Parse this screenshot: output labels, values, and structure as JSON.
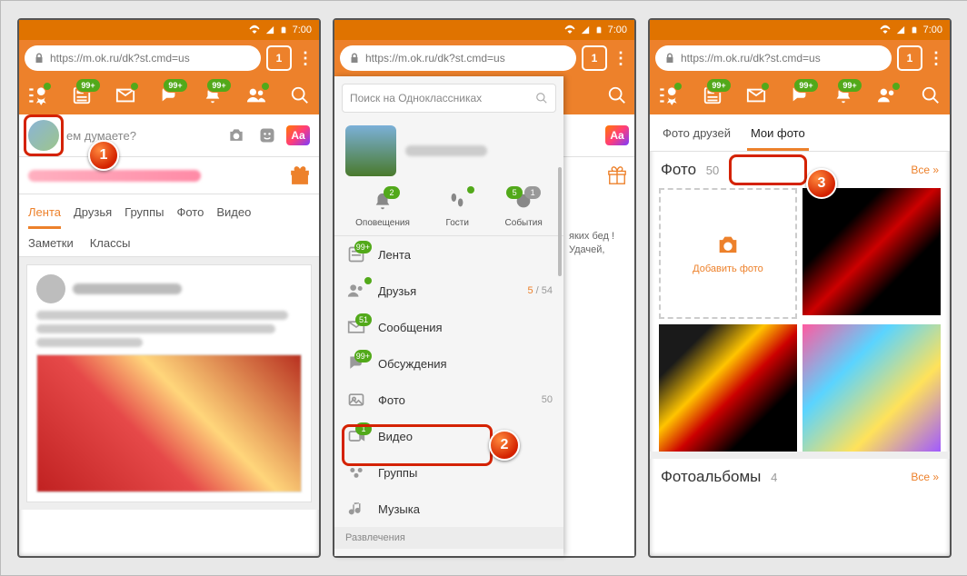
{
  "status": {
    "time": "7:00"
  },
  "urlbar": {
    "url": "https://m.ok.ru/dk?st.cmd=us",
    "tabcount": "1"
  },
  "nav": {
    "badge99": "99+"
  },
  "composer": {
    "prompt": "ем думаете?",
    "aa": "Aa"
  },
  "feedtabs": {
    "lenta": "Лента",
    "druzya": "Друзья",
    "gruppy": "Группы",
    "foto": "Фото",
    "video": "Видео",
    "zametki": "Заметки",
    "klassy": "Классы"
  },
  "drawer": {
    "search": "Поиск на Одноклассниках",
    "top": {
      "notif": "Оповещения",
      "notif_n": "2",
      "guests": "Гости",
      "events": "События",
      "events_n1": "5",
      "events_n2": "1"
    },
    "items": {
      "lenta": {
        "label": "Лента",
        "badge": "99+"
      },
      "druzya": {
        "label": "Друзья",
        "count_new": "5",
        "count_sep": " / ",
        "count_total": "54"
      },
      "msgs": {
        "label": "Сообщения",
        "badge": "51"
      },
      "disc": {
        "label": "Обсуждения",
        "badge": "99+"
      },
      "foto": {
        "label": "Фото",
        "count": "50"
      },
      "video": {
        "label": "Видео",
        "badge": "1"
      },
      "groups": {
        "label": "Группы"
      },
      "music": {
        "label": "Музыка"
      }
    },
    "section": "Развлечения",
    "peek": "яких бед ! Удачей,"
  },
  "photos": {
    "tab_friends": "Фото друзей",
    "tab_my": "Мои фото",
    "title": "Фото",
    "count": "50",
    "all": "Все »",
    "add": "Добавить фото",
    "albums_title": "Фотоальбомы",
    "albums_count": "4",
    "albums_all": "Все »"
  },
  "steps": {
    "s1": "1",
    "s2": "2",
    "s3": "3"
  }
}
